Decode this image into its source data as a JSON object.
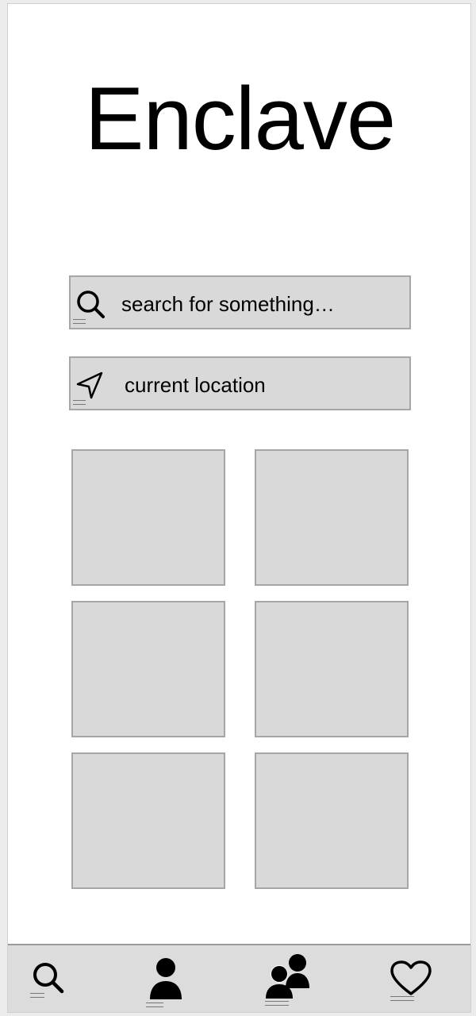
{
  "app": {
    "title": "Enclave"
  },
  "search": {
    "placeholder": "search for something…",
    "icon": "search-icon"
  },
  "location": {
    "label": "current location",
    "icon": "navigation-arrow-icon"
  },
  "grid": {
    "tiles": [
      "",
      "",
      "",
      "",
      "",
      ""
    ]
  },
  "tabbar": {
    "items": [
      {
        "name": "search",
        "icon": "search-icon"
      },
      {
        "name": "profile",
        "icon": "person-icon"
      },
      {
        "name": "community",
        "icon": "people-icon"
      },
      {
        "name": "favorites",
        "icon": "heart-icon"
      }
    ]
  },
  "colors": {
    "placeholder_fill": "#d9d9d9",
    "placeholder_border": "#a6a6a6",
    "tabbar_fill": "#dcdcdc",
    "text": "#000000"
  }
}
